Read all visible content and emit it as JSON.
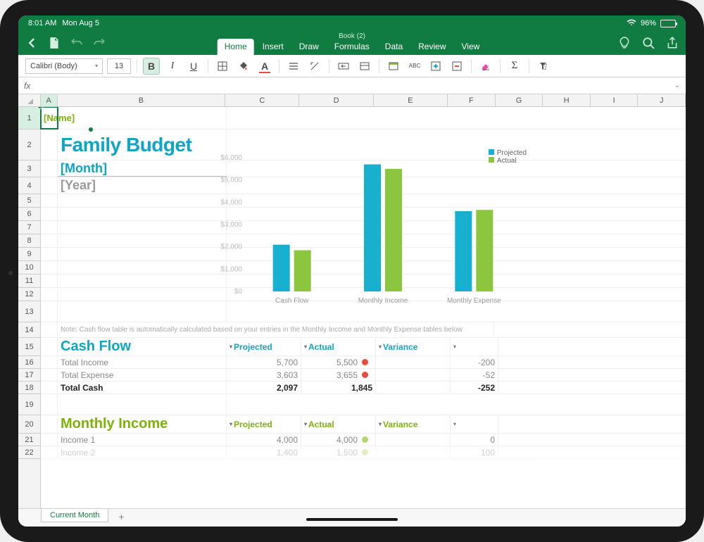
{
  "status": {
    "time": "8:01 AM",
    "date": "Mon Aug 5",
    "battery": "96%"
  },
  "app": {
    "title": "Book (2)",
    "tabs": [
      "Home",
      "Insert",
      "Draw",
      "Formulas",
      "Data",
      "Review",
      "View"
    ],
    "active_tab": "Home"
  },
  "toolbar": {
    "font": "Calibri (Body)",
    "size": "13"
  },
  "formula_bar": {
    "fx": "fx"
  },
  "columns": [
    "A",
    "B",
    "C",
    "D",
    "E",
    "F",
    "G",
    "H",
    "I",
    "J"
  ],
  "rows": [
    1,
    2,
    3,
    4,
    5,
    6,
    7,
    8,
    9,
    10,
    11,
    12,
    13,
    14,
    15,
    16,
    17,
    18,
    19,
    20,
    21,
    22
  ],
  "content": {
    "a1": "[Name]",
    "title": "Family Budget",
    "month": "[Month]",
    "year": "[Year]",
    "note": "Note: Cash flow table is automatically calculated based on your entries in the Monthly Income and Monthly Expense tables below",
    "cashflow_hdr": "Cash Flow",
    "cols": {
      "projected": "Projected",
      "actual": "Actual",
      "variance": "Variance"
    },
    "cashflow": [
      {
        "label": "Total Income",
        "projected": "5,700",
        "actual": "5,500",
        "variance": "-200",
        "dot": "red"
      },
      {
        "label": "Total Expense",
        "projected": "3,603",
        "actual": "3,655",
        "variance": "-52",
        "dot": "red"
      },
      {
        "label": "Total Cash",
        "projected": "2,097",
        "actual": "1,845",
        "variance": "-252",
        "dot": ""
      }
    ],
    "monthly_income_hdr": "Monthly Income",
    "income": [
      {
        "label": "Income 1",
        "projected": "4,000",
        "actual": "4,000",
        "variance": "0",
        "dot": "lime"
      },
      {
        "label": "Income 2",
        "projected": "1,400",
        "actual": "1,500",
        "variance": "100",
        "dot": "lime"
      }
    ],
    "legend": {
      "projected": "Projected",
      "actual": "Actual"
    }
  },
  "chart_data": {
    "type": "bar",
    "categories": [
      "Cash Flow",
      "Monthly Income",
      "Monthly Expense"
    ],
    "series": [
      {
        "name": "Projected",
        "values": [
          2097,
          5700,
          3603
        ],
        "color": "#17b1cf"
      },
      {
        "name": "Actual",
        "values": [
          1845,
          5500,
          3655
        ],
        "color": "#8cc63f"
      }
    ],
    "ylim": [
      0,
      6000
    ],
    "ytick": 1000,
    "title": "",
    "xlabel": "",
    "ylabel": ""
  },
  "sheet": {
    "active": "Current Month"
  }
}
